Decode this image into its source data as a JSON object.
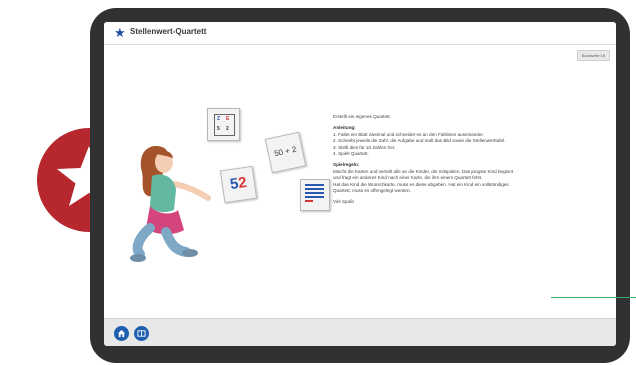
{
  "app": {
    "title": "Stellenwert-Quartett",
    "badge": "Buchseite 18"
  },
  "cards": {
    "card1_a": "E",
    "card1_b": "Z",
    "card1_c": "5",
    "card1_d": "2",
    "card2_text": "50 + 2",
    "card3_tens": "5",
    "card3_ones": "2"
  },
  "content": {
    "intro": "Erstellt ein eigenes Quartett.",
    "instructions_heading": "Anleitung:",
    "steps": [
      "1. Faltet ein Blatt zweimal und schneidet es an den Faltlinien auseinander.",
      "2. Schreibt jeweils die Zahl, die Aufgabe und malt das Bild sowie die Stellenwerttafel.",
      "3. Stellt dies für 10 Zahlen her.",
      "4. Spielt Quartett."
    ],
    "rules_heading": "Spielregeln:",
    "rules_lines": [
      "Mischt die Karten und verteilt alle an die Kinder, die mitspielen. Das jüngste Kind beginnt",
      "und fragt ein anderes Kind nach einer Karte, die ihm einem Quartett fehlt.",
      "Hat das Kind die Wunschkarte, muss es diese abgeben. Hat ein Kind ein vollständiges",
      "Quartett, muss es offengelegt werden."
    ],
    "closing": "Viel Spaß!"
  },
  "toolbar": {
    "home_icon": "home-icon",
    "book_icon": "book-icon"
  },
  "colors": {
    "accent_blue": "#1e5fb0",
    "red_badge": "#b7282e",
    "green_line": "#36a86a",
    "frame": "#2f3133"
  }
}
